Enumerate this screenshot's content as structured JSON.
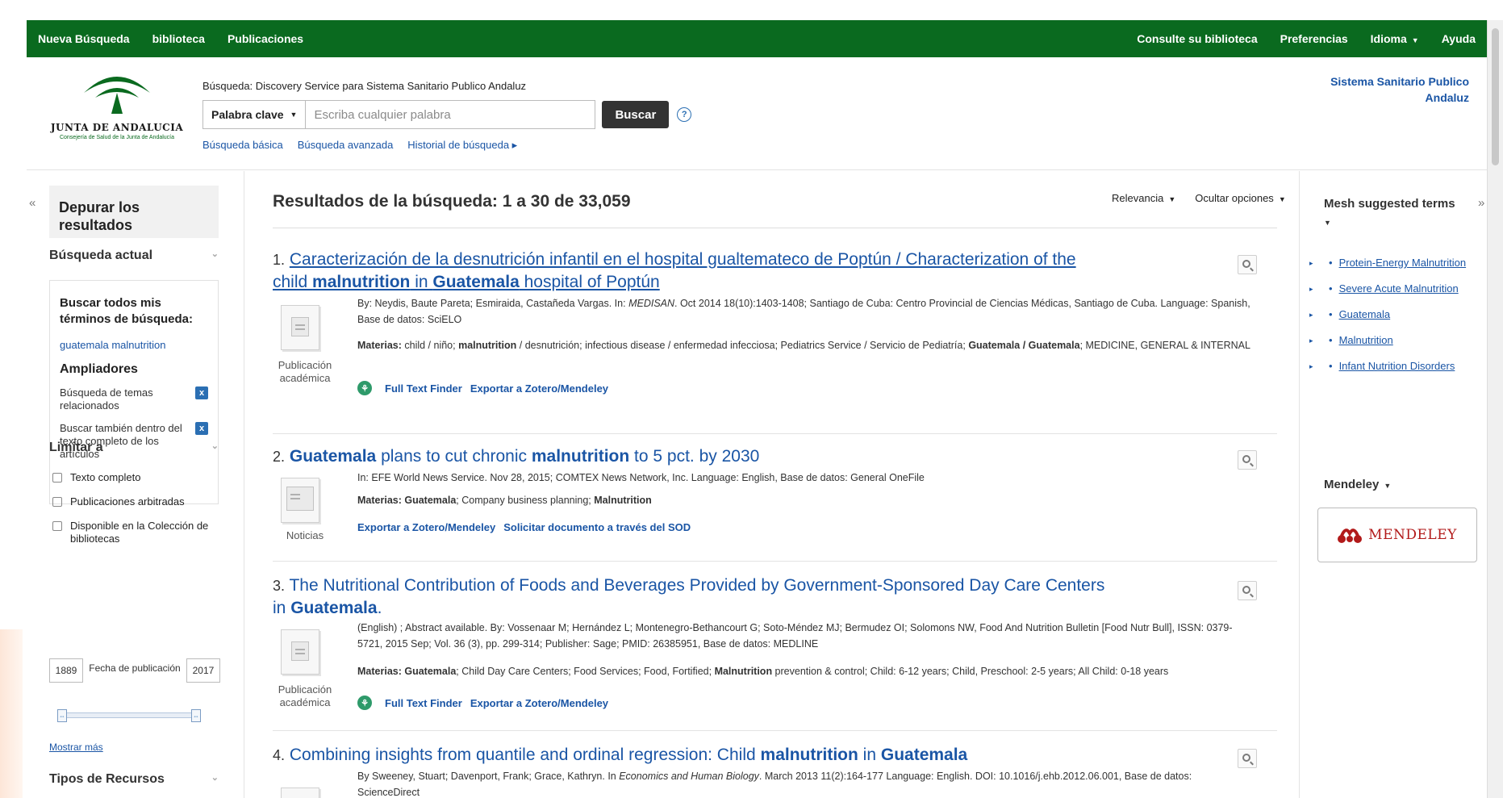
{
  "topnav": {
    "left": [
      "Nueva Búsqueda",
      "biblioteca",
      "Publicaciones"
    ],
    "right": {
      "library": "Consulte su biblioteca",
      "preferences": "Preferencias",
      "language": "Idioma",
      "help": "Ayuda"
    }
  },
  "logo": {
    "name": "JUNTA DE ANDALUCIA",
    "subtitle": "Consejería de Salud de la Junta de Andalucía"
  },
  "search": {
    "scope": "Búsqueda: Discovery Service para Sistema Sanitario Publico Andaluz",
    "field_select": "Palabra clave",
    "placeholder": "Escriba cualquier palabra",
    "button": "Buscar",
    "help_glyph": "?",
    "links": [
      "Búsqueda básica",
      "Búsqueda avanzada",
      "Historial de búsqueda ▸"
    ]
  },
  "institution": "Sistema Sanitario Publico Andaluz",
  "sidebar": {
    "collapse_glyph": "«",
    "refine_title": "Depurar los resultados",
    "current_search_head": "Búsqueda actual",
    "search_all_terms": "Buscar todos mis términos de búsqueda:",
    "term": "guatemala malnutrition",
    "expanders_head": "Ampliadores",
    "expanders": [
      "Búsqueda de temas relacionados",
      "Buscar también dentro del texto completo de los artículos"
    ],
    "limit_head": "Limitar a",
    "limits": [
      "Texto completo",
      "Publicaciones arbitradas",
      "Disponible en la Colección de bibliotecas"
    ],
    "date_from": "1889",
    "date_label": "Fecha de publicación",
    "date_to": "2017",
    "show_more": "Mostrar más",
    "resource_types_head": "Tipos de Recursos"
  },
  "results": {
    "heading_prefix": "Resultados de la búsqueda: ",
    "heading_range": "1 a 30 de 33,059",
    "sort": "Relevancia",
    "options": "Ocultar opciones",
    "items": [
      {
        "num": "1.",
        "title_a": "Caracterización de la desnutrición infantil en el hospital gualtemateco de Poptún / Characterization of the child ",
        "title_b": "malnutrition",
        "title_c": " in ",
        "title_d": "Guatemala",
        "title_e": " hospital of Poptún",
        "type": "Publicación académica",
        "meta1_a": "By: Neydis, Baute Pareta; Esmiraida, Castañeda Vargas. In: ",
        "meta1_src": "MEDISAN",
        "meta1_b": ". Oct 2014 18(10):1403-1408; Santiago de Cuba: Centro Provincial de Ciencias Médicas, Santiago de Cuba. Language: Spanish, Base de datos: SciELO",
        "subj_label": "Materias:",
        "subj_a": " child / niño; ",
        "subj_b": "malnutrition",
        "subj_c": " / desnutrición; infectious disease / enfermedad infecciosa; Pediatrics Service / Servicio de Pediatría; ",
        "subj_d": "Guatemala / Guatemala",
        "subj_e": "; MEDICINE, GENERAL & INTERNAL",
        "link1": "Full Text Finder",
        "link2": "Exportar a Zotero/Mendeley"
      },
      {
        "num": "2.",
        "title_a": "Guatemala",
        "title_b": " plans to cut chronic ",
        "title_c": "malnutrition",
        "title_d": " to 5 pct. by 2030",
        "type": "Noticias",
        "meta1": "In: EFE World News Service. Nov 28, 2015; COMTEX News Network, Inc. Language: English, Base de datos: General OneFile",
        "subj_label": "Materias:",
        "subj_a": " ",
        "subj_b": "Guatemala",
        "subj_c": "; Company business planning; ",
        "subj_d": "Malnutrition",
        "link1": "Exportar a Zotero/Mendeley",
        "link2": "Solicitar documento a través del SOD"
      },
      {
        "num": "3.",
        "title_a": "The Nutritional Contribution of Foods and Beverages Provided by Government-Sponsored Day Care Centers in ",
        "title_b": "Guatemala",
        "title_c": ".",
        "type": "Publicación académica",
        "meta1": "(English) ; Abstract available. By: Vossenaar M; Hernández L; Montenegro-Bethancourt G; Soto-Méndez MJ; Bermudez OI; Solomons NW, Food And Nutrition Bulletin [Food Nutr Bull], ISSN: 0379-5721, 2015 Sep; Vol. 36 (3), pp. 299-314; Publisher: Sage; PMID: 26385951, Base de datos: MEDLINE",
        "subj_label": "Materias:",
        "subj_a": " ",
        "subj_b": "Guatemala",
        "subj_c": "; Child Day Care Centers; Food Services; Food, Fortified; ",
        "subj_d": "Malnutrition",
        "subj_e": " prevention & control; Child: 6-12 years; Child, Preschool: 2-5 years; All Child: 0-18 years",
        "link1": "Full Text Finder",
        "link2": "Exportar a Zotero/Mendeley"
      },
      {
        "num": "4.",
        "title_a": "Combining insights from quantile and ordinal regression: Child ",
        "title_b": "malnutrition",
        "title_c": " in ",
        "title_d": "Guatemala",
        "meta1_a": "By Sweeney, Stuart; Davenport, Frank; Grace, Kathryn. In ",
        "meta1_src": "Economics and Human Biology",
        "meta1_b": ". March 2013 11(2):164-177 Language: English. DOI: 10.1016/j.ehb.2012.06.001, Base de datos: ScienceDirect"
      }
    ]
  },
  "right_panel": {
    "collapse_glyph": "»",
    "mesh_head": "Mesh suggested terms",
    "mesh_terms": [
      "Protein-Energy Malnutrition",
      "Severe Acute Malnutrition",
      "Guatemala",
      "Malnutrition",
      "Infant Nutrition Disorders"
    ],
    "mendeley_head": "Mendeley",
    "mendeley_logo_text": "MENDELEY"
  },
  "colors": {
    "topbar": "#0a6a1f",
    "link": "#1a55a5",
    "button": "#333333"
  }
}
